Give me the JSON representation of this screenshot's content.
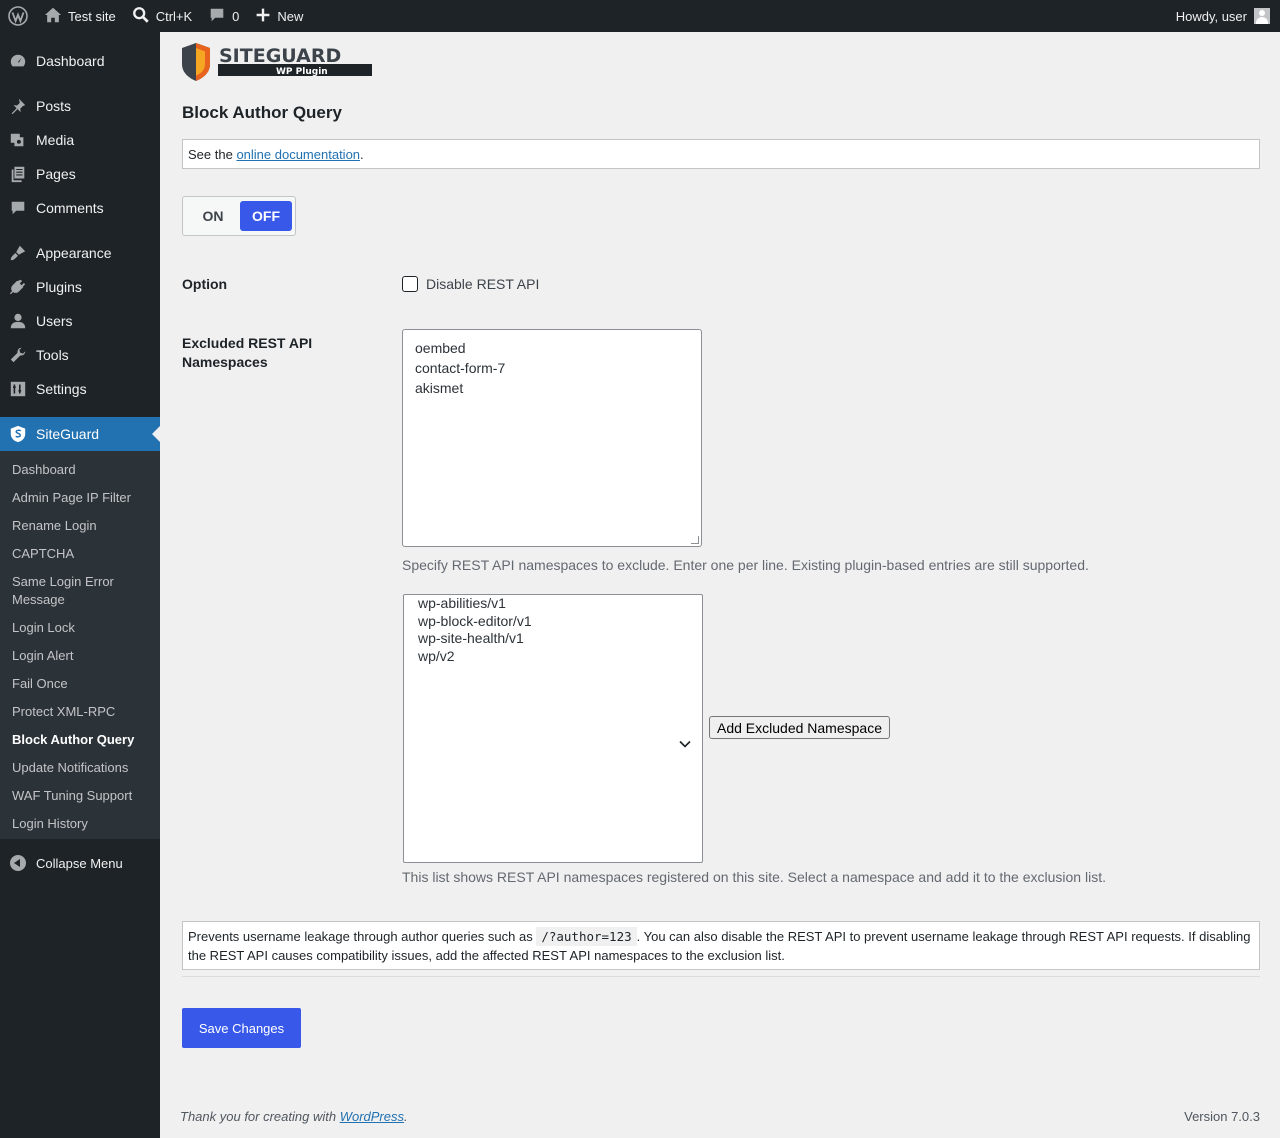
{
  "adminbar": {
    "site_name": "Test site",
    "search_shortcut": "Ctrl+K",
    "comments_count": "0",
    "new_label": "New",
    "howdy": "Howdy, user"
  },
  "sidebar": {
    "menu": [
      {
        "label": "Dashboard",
        "icon": "dashboard-icon"
      },
      {
        "label": "Posts",
        "icon": "pin-icon"
      },
      {
        "label": "Media",
        "icon": "media-icon"
      },
      {
        "label": "Pages",
        "icon": "pages-icon"
      },
      {
        "label": "Comments",
        "icon": "comment-icon"
      },
      {
        "label": "Appearance",
        "icon": "brush-icon"
      },
      {
        "label": "Plugins",
        "icon": "plugin-icon"
      },
      {
        "label": "Users",
        "icon": "user-icon"
      },
      {
        "label": "Tools",
        "icon": "wrench-icon"
      },
      {
        "label": "Settings",
        "icon": "settings-icon"
      },
      {
        "label": "SiteGuard",
        "icon": "siteguard-icon"
      }
    ],
    "submenu": [
      "Dashboard",
      "Admin Page IP Filter",
      "Rename Login",
      "CAPTCHA",
      "Same Login Error Message",
      "Login Lock",
      "Login Alert",
      "Fail Once",
      "Protect XML-RPC",
      "Block Author Query",
      "Update Notifications",
      "WAF Tuning Support",
      "Login History"
    ],
    "collapse_label": "Collapse Menu"
  },
  "logo": {
    "text": "SITEGUARD",
    "subtext": "WP Plugin"
  },
  "page": {
    "title": "Block Author Query",
    "doc_prefix": "See the ",
    "doc_link": "online documentation",
    "doc_suffix": "."
  },
  "toggle": {
    "on_label": "ON",
    "off_label": "OFF",
    "selected": "OFF"
  },
  "option": {
    "label": "Option",
    "checkbox_label": "Disable REST API",
    "checked": false
  },
  "excluded": {
    "label": "Excluded REST API Namespaces",
    "values": [
      "oembed",
      "contact-form-7",
      "akismet"
    ],
    "description": "Specify REST API namespaces to exclude. Enter one per line. Existing plugin-based entries are still supported."
  },
  "namespaces": {
    "options": [
      "wp-abilities/v1",
      "wp-block-editor/v1",
      "wp-site-health/v1",
      "wp/v2"
    ],
    "add_button": "Add Excluded Namespace",
    "description": "This list shows REST API namespaces registered on this site. Select a namespace and add it to the exclusion list."
  },
  "info": {
    "before": "Prevents username leakage through author queries such as ",
    "code": "/?author=123",
    "after": ". You can also disable the REST API to prevent username leakage through REST API requests. If disabling the REST API causes compatibility issues, add the affected REST API namespaces to the exclusion list."
  },
  "save_label": "Save Changes",
  "footer": {
    "thanks_prefix": "Thank you for creating with ",
    "thanks_link": "WordPress",
    "thanks_suffix": ".",
    "version": "Version 7.0.3"
  },
  "colors": {
    "accent": "#3858e9",
    "menu_current": "#2271b1",
    "adminbar": "#1d2327"
  }
}
